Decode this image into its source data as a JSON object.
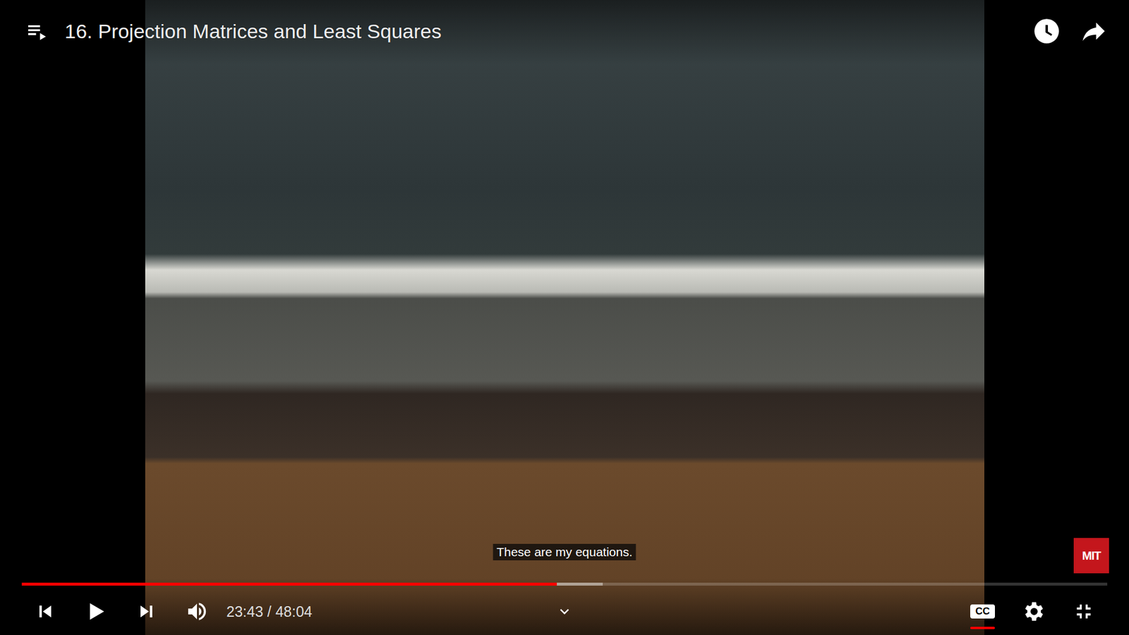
{
  "player": {
    "title": "16. Projection Matrices and Least Squares",
    "caption": "These are my equations.",
    "time": "23:43 / 48:04",
    "progress": {
      "level": 0.493,
      "buffered": 0.535
    },
    "paused": true,
    "captions_on": true,
    "cc_label": "CC",
    "watermark": "MIT"
  }
}
